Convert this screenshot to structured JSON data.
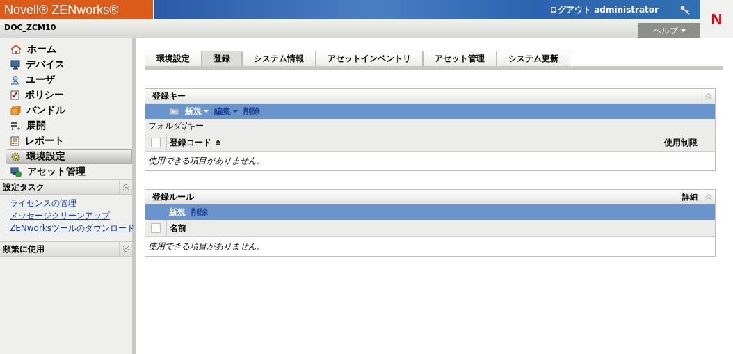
{
  "header": {
    "brand": "Novell® ZENworks®",
    "logout": "ログアウト administrator",
    "zone": "DOC_ZCM10",
    "help": "ヘルプ",
    "logo": "N"
  },
  "sidebar": {
    "items": [
      {
        "label": "ホーム",
        "selected": false
      },
      {
        "label": "デバイス",
        "selected": false
      },
      {
        "label": "ユーザ",
        "selected": false
      },
      {
        "label": "ポリシー",
        "selected": false
      },
      {
        "label": "バンドル",
        "selected": false
      },
      {
        "label": "展開",
        "selected": false
      },
      {
        "label": "レポート",
        "selected": false
      },
      {
        "label": "環境設定",
        "selected": true
      },
      {
        "label": "アセット管理",
        "selected": false
      }
    ],
    "sections": [
      {
        "title": "設定タスク",
        "expanded": true,
        "links": [
          "ライセンスの管理",
          "メッセージクリーンアップ",
          "ZENworksツールのダウンロード"
        ]
      },
      {
        "title": "頻繁に使用",
        "expanded": false
      }
    ]
  },
  "tabs": [
    {
      "label": "環境設定",
      "selected": false
    },
    {
      "label": "登録",
      "selected": true
    },
    {
      "label": "システム情報",
      "selected": false
    },
    {
      "label": "アセットインベントリ",
      "selected": false
    },
    {
      "label": "アセット管理",
      "selected": false
    },
    {
      "label": "システム更新",
      "selected": false
    }
  ],
  "panels": [
    {
      "title": "登録キー",
      "folder_icon": true,
      "all_checked": false,
      "actions": [
        {
          "label": "新規",
          "menu": true,
          "disabled": false
        },
        {
          "label": "編集",
          "menu": true,
          "disabled": true
        },
        {
          "label": "削除",
          "menu": false,
          "disabled": true
        }
      ],
      "folder": "フォルダ:/キー",
      "columns": [
        {
          "label": "登録コード",
          "sorted": true
        },
        {
          "label": "使用制限",
          "sorted": false
        }
      ],
      "empty": "使用できる項目がありません。"
    },
    {
      "title": "登録ルール",
      "details": "詳細",
      "folder_icon": false,
      "all_checked": false,
      "actions": [
        {
          "label": "新規",
          "menu": false,
          "disabled": false
        },
        {
          "label": "削除",
          "menu": false,
          "disabled": true
        }
      ],
      "columns": [
        {
          "label": "名前",
          "sorted": false
        }
      ],
      "empty": "使用できる項目がありません。"
    }
  ]
}
